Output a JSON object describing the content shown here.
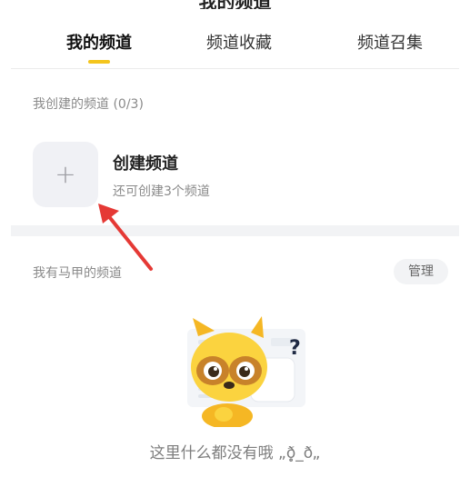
{
  "header": {
    "title_clipped": "我的频道"
  },
  "tabs": [
    {
      "label": "我的频道",
      "active": true
    },
    {
      "label": "频道收藏",
      "active": false
    },
    {
      "label": "频道召集",
      "active": false
    }
  ],
  "created_section": {
    "title": "我创建的频道 (0/3)",
    "create_icon": "plus-icon",
    "create_title": "创建频道",
    "create_subtitle": "还可创建3个频道"
  },
  "alt_section": {
    "title": "我有马甲的频道",
    "manage_label": "管理"
  },
  "empty_state": {
    "illustration": "raccoon-question-illustration",
    "text": "这里什么都没有哦 „ð̥̥̥̥_ð„"
  },
  "colors": {
    "accent_yellow": "#f4c51d",
    "annotation_arrow": "#e53935"
  }
}
